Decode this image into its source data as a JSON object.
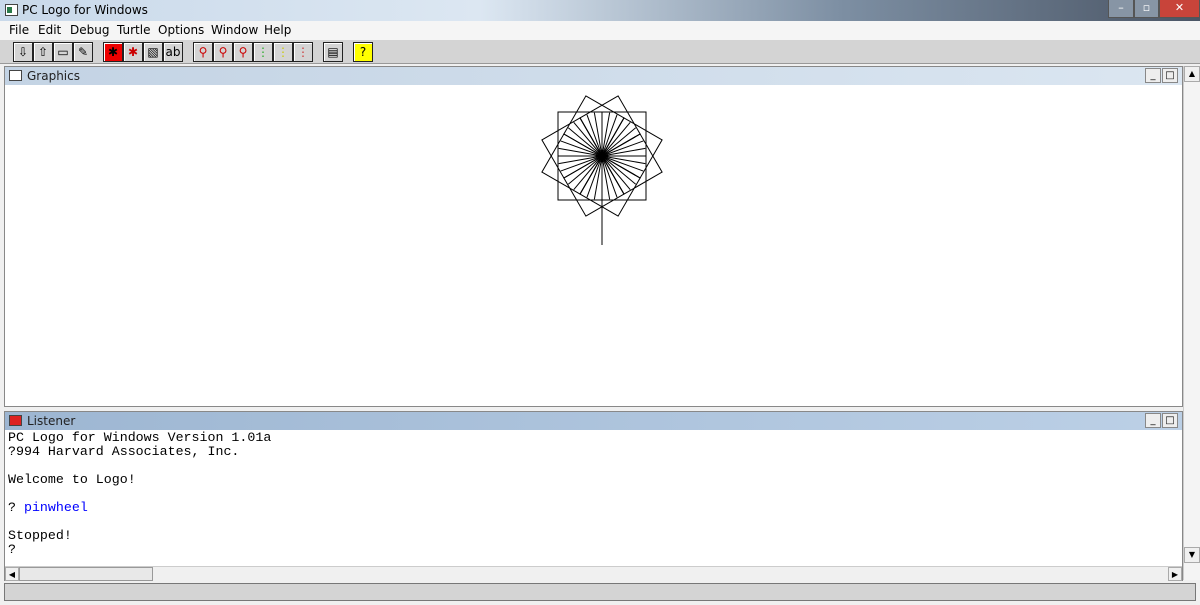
{
  "window": {
    "title": "PC Logo for Windows"
  },
  "menu": [
    "File",
    "Edit",
    "Debug",
    "Turtle",
    "Options",
    "Window",
    "Help"
  ],
  "toolbar": [
    {
      "icon": "load-icon",
      "g": "⇩"
    },
    {
      "icon": "save-icon",
      "g": "⇧"
    },
    {
      "icon": "print-icon",
      "g": "▭"
    },
    {
      "icon": "edit-icon",
      "g": "✎"
    },
    {
      "icon": "turtle-show-icon",
      "g": "✱"
    },
    {
      "icon": "turtle-icon",
      "g": "✱"
    },
    {
      "icon": "pattern-icon",
      "g": "▧"
    },
    {
      "icon": "font-icon",
      "g": "ab"
    },
    {
      "icon": "zoom-in-icon",
      "g": "⚲"
    },
    {
      "icon": "zoom-out-icon",
      "g": "⚲"
    },
    {
      "icon": "zoom-reset-icon",
      "g": "⚲"
    },
    {
      "icon": "go-light-icon",
      "g": "⋮"
    },
    {
      "icon": "pause-light-icon",
      "g": "⋮"
    },
    {
      "icon": "stop-light-icon",
      "g": "⋮"
    },
    {
      "icon": "graphics-window-icon",
      "g": "▤"
    },
    {
      "icon": "help-icon",
      "g": "?"
    }
  ],
  "graphics": {
    "title": "Graphics"
  },
  "listener": {
    "title": "Listener",
    "lines": [
      {
        "text": "PC Logo for Windows Version 1.01a",
        "color": "#000000"
      },
      {
        "text": "?994 Harvard Associates, Inc.",
        "color": "#000000"
      },
      {
        "text": "",
        "color": "#000000"
      },
      {
        "text": "Welcome to Logo!",
        "color": "#000000"
      },
      {
        "text": "",
        "color": "#000000"
      },
      {
        "prompt": "? ",
        "text": "pinwheel",
        "color": "#0000ff"
      },
      {
        "text": "",
        "color": "#000000"
      },
      {
        "text": "Stopped!",
        "color": "#000000"
      },
      {
        "text": "?",
        "color": "#000000"
      }
    ]
  }
}
